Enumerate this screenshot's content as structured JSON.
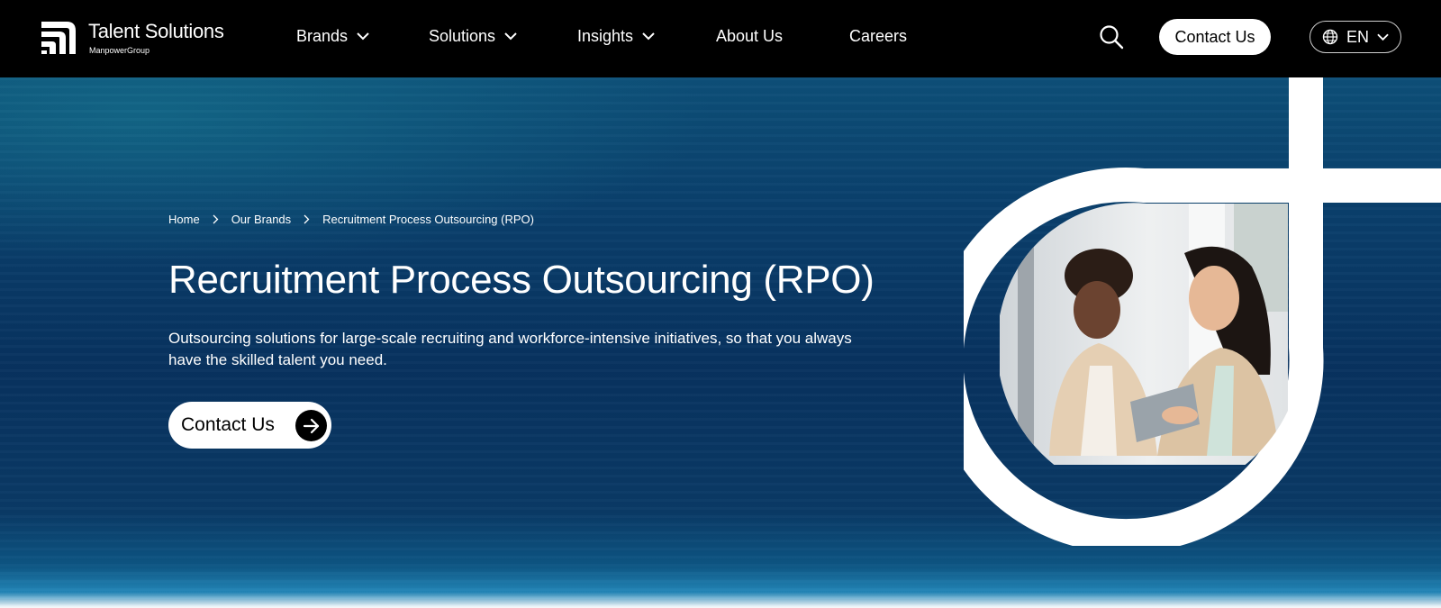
{
  "brand": {
    "name": "Talent Solutions",
    "parent": "ManpowerGroup"
  },
  "nav": {
    "items": [
      {
        "label": "Brands",
        "dropdown": true
      },
      {
        "label": "Solutions",
        "dropdown": true
      },
      {
        "label": "Insights",
        "dropdown": true
      },
      {
        "label": "About Us",
        "dropdown": false
      },
      {
        "label": "Careers",
        "dropdown": false
      }
    ],
    "search_icon": "search-icon",
    "contact_label": "Contact Us",
    "language": "EN",
    "language_icon": "globe-icon"
  },
  "breadcrumb": [
    "Home",
    "Our Brands",
    "Recruitment Process Outsourcing (RPO)"
  ],
  "hero": {
    "title": "Recruitment Process Outsourcing (RPO)",
    "description": "Outsourcing solutions for large-scale recruiting and workforce-intensive initiatives, so that you always have the skilled talent you need.",
    "cta_label": "Contact Us",
    "cta_icon": "arrow-right-icon",
    "image_alt": "two-women-looking-at-tablet-photo"
  },
  "colors": {
    "topbar": "#000000",
    "hero_base": "#08325f",
    "hero_accent": "#2386b8",
    "button_bg": "#ffffff"
  }
}
